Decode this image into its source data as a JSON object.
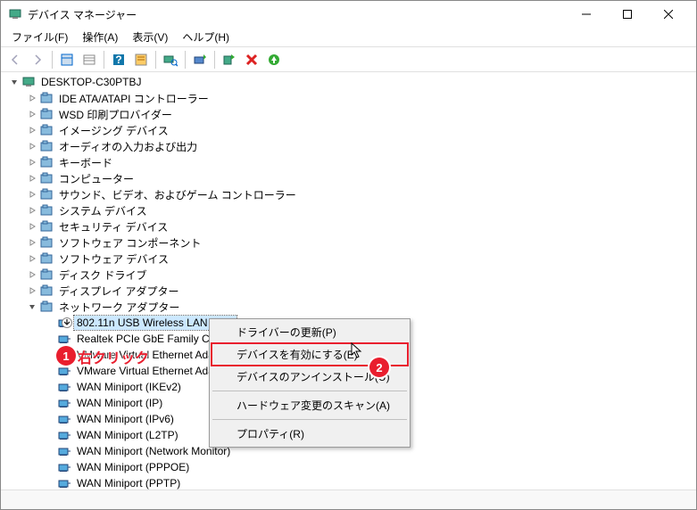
{
  "window": {
    "title": "デバイス マネージャー"
  },
  "menus": {
    "file": "ファイル(F)",
    "action": "操作(A)",
    "view": "表示(V)",
    "help": "ヘルプ(H)"
  },
  "tree": {
    "root": "DESKTOP-C30PTBJ",
    "categories": [
      "IDE ATA/ATAPI コントローラー",
      "WSD 印刷プロバイダー",
      "イメージング デバイス",
      "オーディオの入力および出力",
      "キーボード",
      "コンピューター",
      "サウンド、ビデオ、およびゲーム コントローラー",
      "システム デバイス",
      "セキュリティ デバイス",
      "ソフトウェア コンポーネント",
      "ソフトウェア デバイス",
      "ディスク ドライブ",
      "ディスプレイ アダプター",
      "ネットワーク アダプター"
    ],
    "networkDevices": [
      "802.11n USB Wireless LAN Card",
      "Realtek PCIe GbE Family Controller",
      "VMware Virtual Ethernet Adapter",
      "VMware Virtual Ethernet Adapter",
      "WAN Miniport (IKEv2)",
      "WAN Miniport (IP)",
      "WAN Miniport (IPv6)",
      "WAN Miniport (L2TP)",
      "WAN Miniport (Network Monitor)",
      "WAN Miniport (PPPOE)",
      "WAN Miniport (PPTP)"
    ]
  },
  "contextMenu": {
    "updateDriver": "ドライバーの更新(P)",
    "enableDevice": "デバイスを有効にする(E)",
    "uninstall": "デバイスのアンインストール(U)",
    "scanHardware": "ハードウェア変更のスキャン(A)",
    "properties": "プロパティ(R)"
  },
  "annotations": {
    "rightClick": "右クリック",
    "badge1": "1",
    "badge2": "2"
  }
}
